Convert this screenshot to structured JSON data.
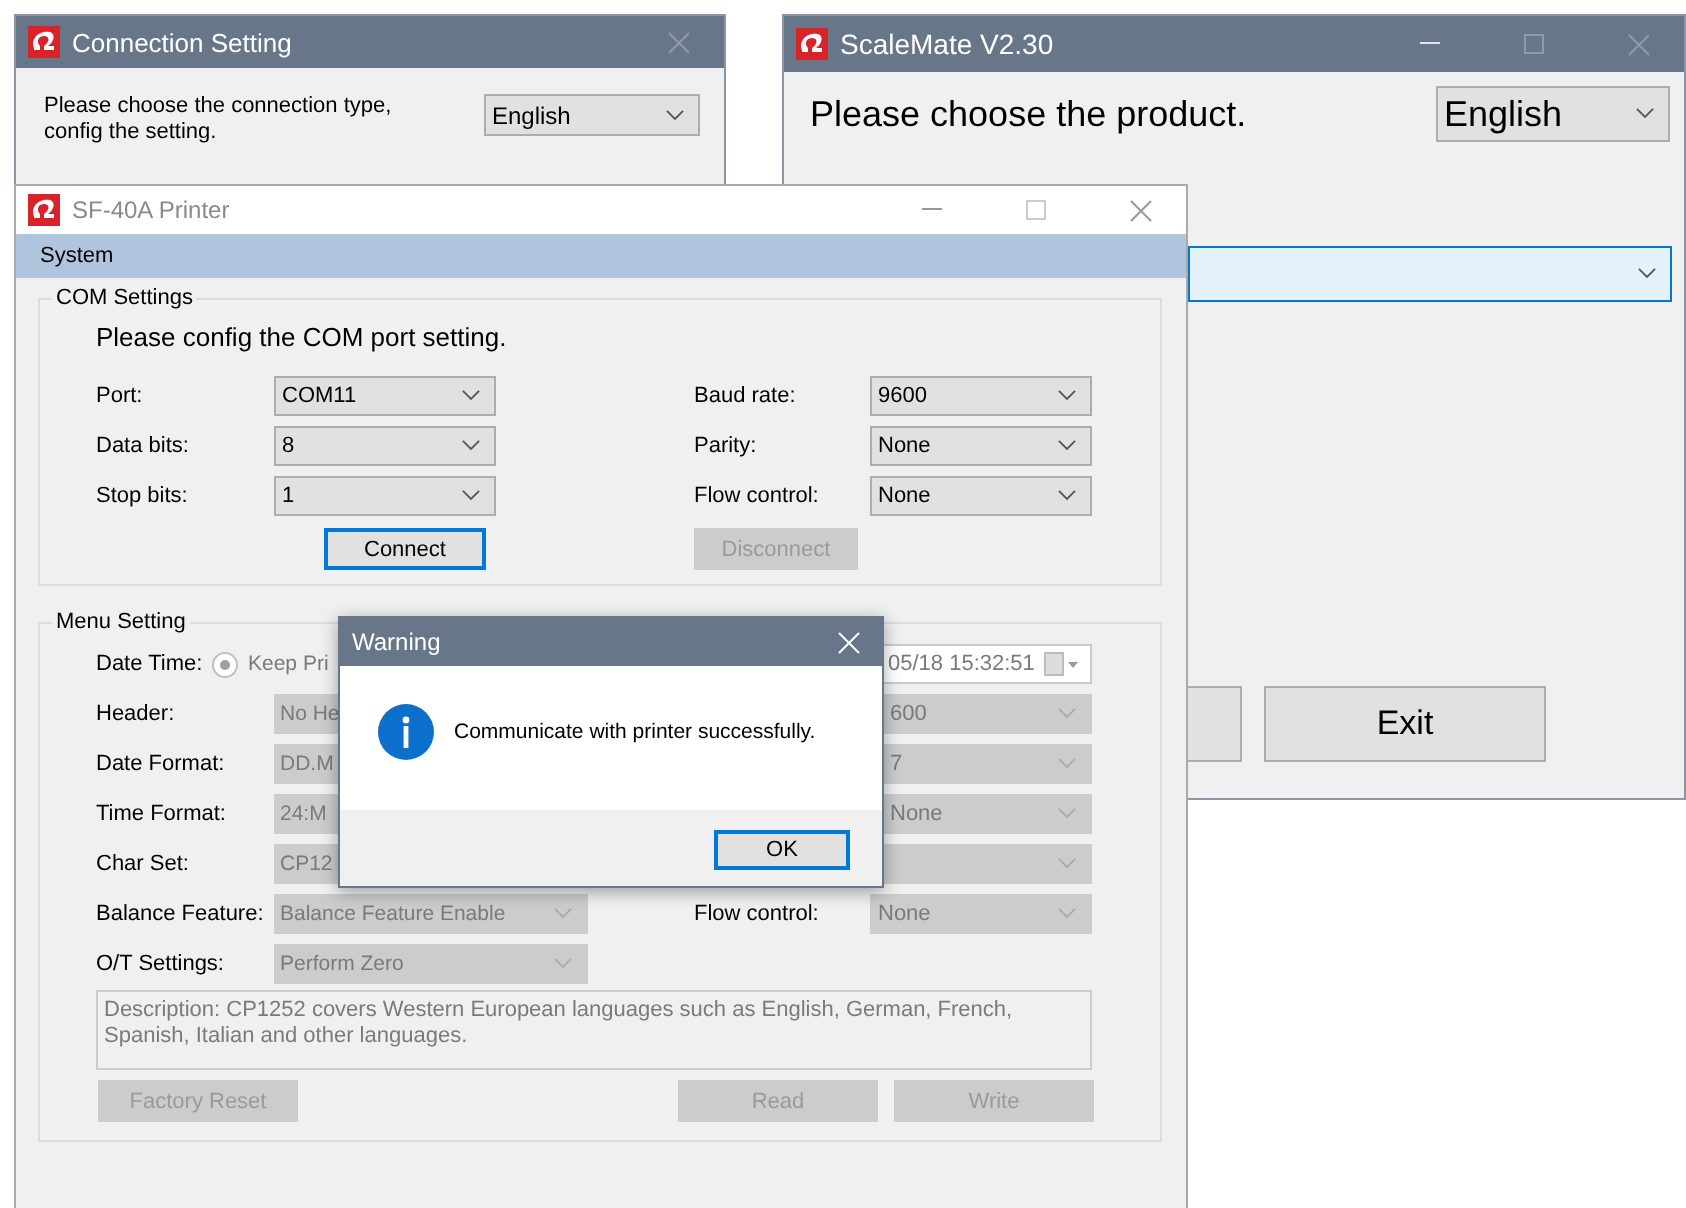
{
  "connection_window": {
    "title": "Connection Setting",
    "prompt": "Please choose the connection type, config the setting.",
    "language": "English"
  },
  "scalemate_window": {
    "title": "ScaleMate  V2.30",
    "prompt": "Please choose the product.",
    "language": "English",
    "exit_button": "Exit"
  },
  "printer_window": {
    "title": "SF-40A Printer",
    "active": false,
    "menu": [
      "System"
    ],
    "com_settings": {
      "title": "COM Settings",
      "prompt": "Please config the COM port setting.",
      "rows": [
        {
          "label": "Port:",
          "value": "COM11",
          "right_label": "Baud rate:",
          "right_value": "9600"
        },
        {
          "label": "Data bits:",
          "value": "8",
          "right_label": "Parity:",
          "right_value": "None"
        },
        {
          "label": "Stop bits:",
          "value": "1",
          "right_label": "Flow control:",
          "right_value": "None"
        }
      ],
      "buttons": [
        {
          "label": "Connect",
          "disabled": false,
          "focused": true
        },
        {
          "label": "Disconnect",
          "disabled": true,
          "focused": false
        }
      ]
    },
    "menu_setting": {
      "title": "Menu Setting",
      "rows": [
        {
          "label": "Date Time:",
          "kind": "radio",
          "value": "Keep Pri",
          "selected": true,
          "right": {
            "kind": "date",
            "value": "05/18 15:32:51"
          }
        },
        {
          "label": "Header:",
          "kind": "select",
          "value": "No He",
          "right": {
            "kind": "select",
            "value": "600"
          }
        },
        {
          "label": "Date Format:",
          "kind": "select",
          "value": "DD.M",
          "right": {
            "kind": "select",
            "value": "7"
          }
        },
        {
          "label": "Time Format:",
          "kind": "select",
          "value": "24:M",
          "right": {
            "kind": "select",
            "value": "None"
          }
        },
        {
          "label": "Char Set:",
          "kind": "select",
          "value": "CP12",
          "right": {
            "kind": "select"
          }
        },
        {
          "label": "Balance Feature:",
          "kind": "select",
          "value": "Balance Feature Enable",
          "right": {
            "kind": "select",
            "label": "Flow control:",
            "value": "None"
          }
        },
        {
          "label": "O/T Settings:",
          "kind": "select",
          "value": "Perform Zero"
        }
      ],
      "description": "Description: CP1252 covers Western European languages such as English, German, French, Spanish, Italian and other languages.",
      "buttons": [
        {
          "label": "Factory Reset",
          "disabled": true
        },
        {
          "label": "Read",
          "disabled": true
        },
        {
          "label": "Write",
          "disabled": true
        }
      ]
    }
  },
  "dialog": {
    "title": "Warning",
    "message": "Communicate with printer successfully.",
    "button": "OK"
  }
}
